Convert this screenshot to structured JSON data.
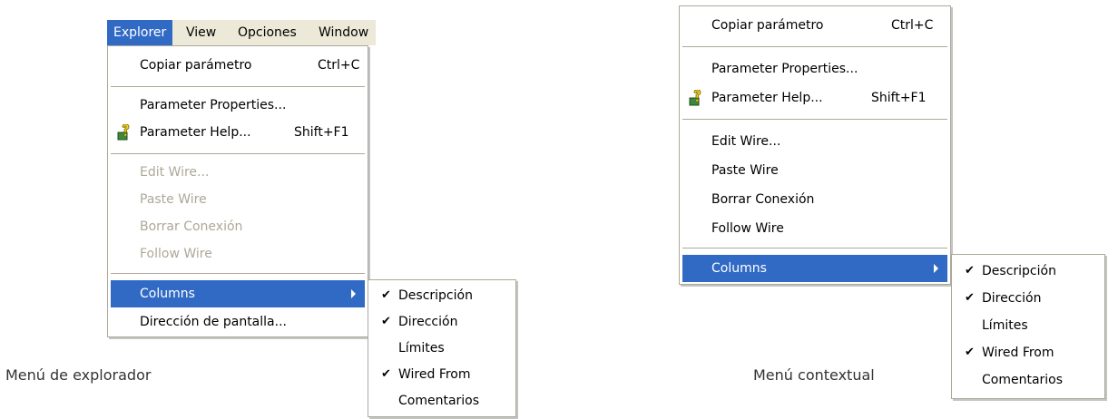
{
  "left_figure": {
    "menubar": [
      "Explorer",
      "View",
      "Opciones",
      "Window"
    ],
    "menu": {
      "copy": {
        "label": "Copiar parámetro",
        "shortcut": "Ctrl+C"
      },
      "props": {
        "label": "Parameter Properties..."
      },
      "help": {
        "label": "Parameter Help...",
        "shortcut": "Shift+F1",
        "icon": "parameter-help-icon"
      },
      "edit_wire": {
        "label": "Edit Wire..."
      },
      "paste_wire": {
        "label": "Paste Wire"
      },
      "borrar": {
        "label": "Borrar Conexión"
      },
      "follow": {
        "label": "Follow Wire"
      },
      "columns": {
        "label": "Columns"
      },
      "direccion": {
        "label": "Dirección de pantalla..."
      }
    },
    "submenu": [
      {
        "label": "Descripción",
        "checked": true
      },
      {
        "label": "Dirección",
        "checked": true
      },
      {
        "label": "Límites",
        "checked": false
      },
      {
        "label": "Wired From",
        "checked": true
      },
      {
        "label": "Comentarios",
        "checked": false
      }
    ],
    "caption": "Menú de explorador"
  },
  "right_figure": {
    "menu": {
      "copy": {
        "label": "Copiar parámetro",
        "shortcut": "Ctrl+C"
      },
      "props": {
        "label": "Parameter Properties..."
      },
      "help": {
        "label": "Parameter Help...",
        "shortcut": "Shift+F1",
        "icon": "parameter-help-icon"
      },
      "edit_wire": {
        "label": "Edit Wire..."
      },
      "paste_wire": {
        "label": "Paste Wire"
      },
      "borrar": {
        "label": "Borrar Conexión"
      },
      "follow": {
        "label": "Follow Wire"
      },
      "columns": {
        "label": "Columns"
      }
    },
    "submenu": [
      {
        "label": "Descripción",
        "checked": true
      },
      {
        "label": "Dirección",
        "checked": true
      },
      {
        "label": "Límites",
        "checked": false
      },
      {
        "label": "Wired From",
        "checked": true
      },
      {
        "label": "Comentarios",
        "checked": false
      }
    ],
    "caption": "Menú contextual"
  },
  "colors": {
    "highlight": "#316ac5",
    "menubar": "#ece9d8",
    "disabled": "#aca899",
    "border": "#aca899"
  }
}
